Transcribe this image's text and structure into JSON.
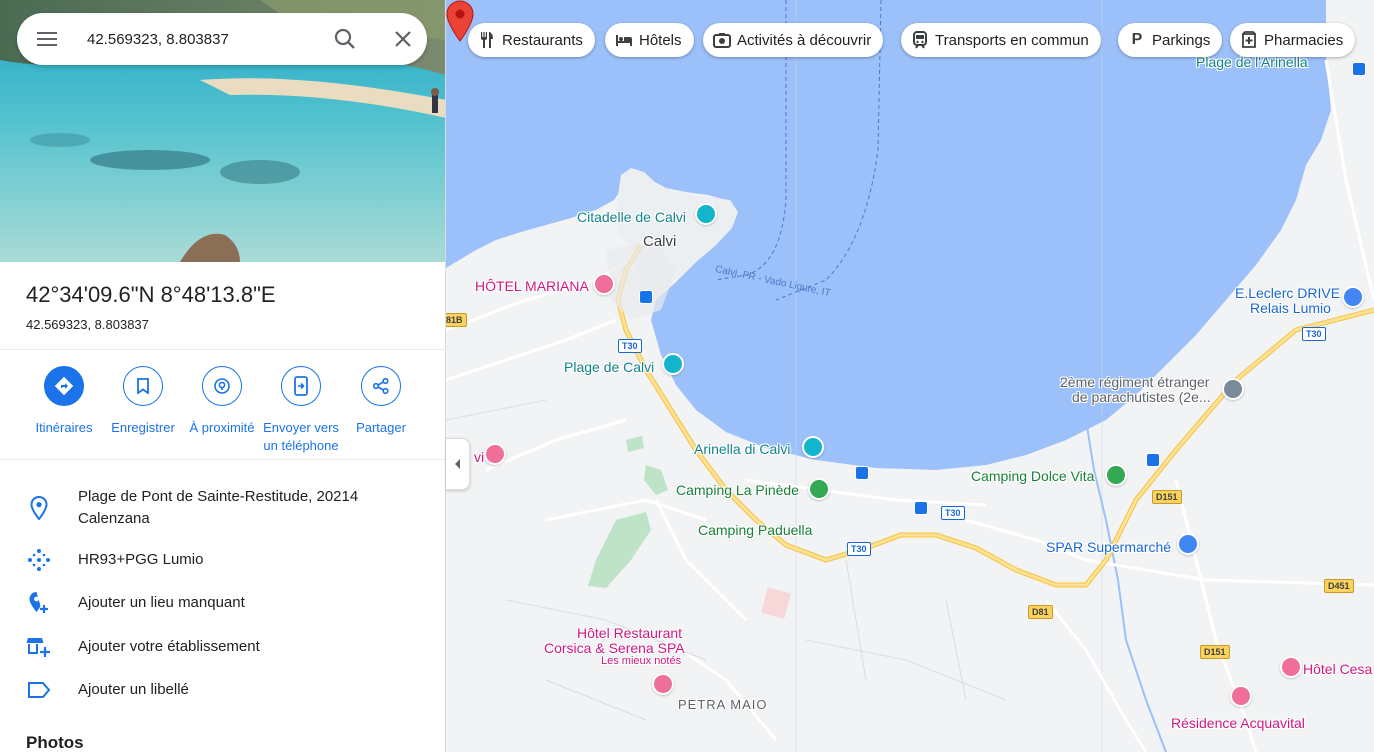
{
  "search": {
    "value": "42.569323, 8.803837",
    "menu_icon": "menu-icon",
    "search_icon": "search-icon",
    "clear_icon": "close-icon"
  },
  "place": {
    "title": "42°34'09.6\"N 8°48'13.8\"E",
    "subtitle": "42.569323, 8.803837"
  },
  "actions": [
    {
      "label": "Itinéraires",
      "icon": "directions-icon"
    },
    {
      "label": "Enregistrer",
      "icon": "bookmark-icon"
    },
    {
      "label": "À proximité",
      "icon": "nearby-icon"
    },
    {
      "label": "Envoyer vers un téléphone",
      "icon": "send-to-phone-icon"
    },
    {
      "label": "Partager",
      "icon": "share-icon"
    }
  ],
  "info": [
    {
      "text": "Plage de Pont de Sainte-Restitude, 20214 Calenzana",
      "icon": "location-pin-icon"
    },
    {
      "text": "HR93+PGG Lumio",
      "icon": "plus-code-icon"
    },
    {
      "text": "Ajouter un lieu manquant",
      "icon": "add-place-icon"
    },
    {
      "text": "Ajouter votre établissement",
      "icon": "add-business-icon"
    },
    {
      "text": "Ajouter un libellé",
      "icon": "label-icon"
    }
  ],
  "photos_title": "Photos",
  "chips": [
    {
      "label": "Restaurants",
      "icon": "restaurant-icon"
    },
    {
      "label": "Hôtels",
      "icon": "hotel-icon"
    },
    {
      "label": "Activités à découvrir",
      "icon": "camera-icon"
    },
    {
      "label": "Transports en commun",
      "icon": "train-icon"
    },
    {
      "label": "Parkings",
      "icon": "parking-icon"
    },
    {
      "label": "Pharmacies",
      "icon": "pharmacy-icon"
    }
  ],
  "map": {
    "labels": {
      "citadelle": "Citadelle de Calvi",
      "calvi": "Calvi",
      "hotel_mariana": "HÔTEL MARIANA",
      "plage_calvi": "Plage de Calvi",
      "arinella_calvi": "Arinella di Calvi",
      "camping_pinede": "Camping La Pinède",
      "camping_paduella": "Camping Paduella",
      "hotel_restaurant_1": "Hôtel Restaurant",
      "hotel_restaurant_2": "Corsica & Serena SPA",
      "mieux_notes": "Les mieux notés",
      "petra_maio": "PETRA MAIO",
      "plage_arinella": "Plage de l'Arinella",
      "eleclerc_1": "E.Leclerc DRIVE",
      "eleclerc_2": "Relais Lumio",
      "regiment_1": "2ème régiment étranger",
      "regiment_2": "de parachutistes (2e...",
      "camping_dolce": "Camping Dolce Vita",
      "spar": "SPAR Supermarché",
      "hotel_cesa": "Hôtel Cesa",
      "residence": "Résidence Acquavital",
      "vi_partial": "vi",
      "ferry": "Calvi, FR - Vado Ligure, IT"
    },
    "roads": {
      "t30_a": "T30",
      "t30_b": "T30",
      "t30_c": "T30",
      "t30_d": "T30",
      "d151_a": "D151",
      "d151_b": "D151",
      "d81": "D81",
      "d451": "D451",
      "r18": "81B"
    }
  }
}
